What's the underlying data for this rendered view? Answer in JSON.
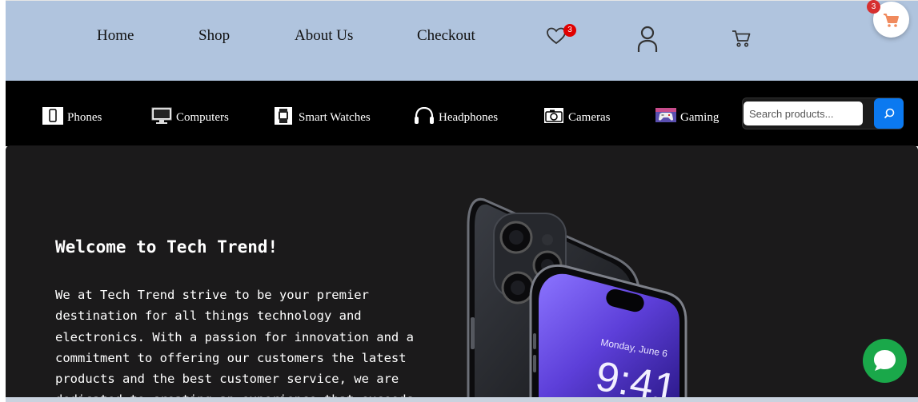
{
  "nav": {
    "links": [
      "Home",
      "Shop",
      "About Us",
      "Checkout"
    ],
    "wishlist_count": "3",
    "floating_cart_count": "3"
  },
  "categories": [
    {
      "label": "Phones",
      "icon": "phone-icon"
    },
    {
      "label": "Computers",
      "icon": "computer-icon"
    },
    {
      "label": "Smart Watches",
      "icon": "smartwatch-icon"
    },
    {
      "label": "Headphones",
      "icon": "headphones-icon"
    },
    {
      "label": "Cameras",
      "icon": "camera-icon"
    },
    {
      "label": "Gaming",
      "icon": "gaming-icon"
    }
  ],
  "search": {
    "placeholder": "Search products..."
  },
  "hero": {
    "title": "Welcome to Tech Trend!",
    "text": "We at Tech Trend strive to be your premier destination for all things technology and electronics. With a passion for innovation and a commitment to offering our customers the latest products and the best customer service, we are dedicated to creating an experience that exceeds"
  },
  "phone_screen": {
    "date": "Monday, June 6",
    "time": "9:41"
  },
  "colors": {
    "nav_bg": "#b0c4de",
    "category_bg": "#000000",
    "hero_bg": "#1b1a1b",
    "search_button": "#0b79f0",
    "chat_button": "#1aa84a",
    "badge": "#e00000",
    "cart_accent": "#f08a5d"
  }
}
